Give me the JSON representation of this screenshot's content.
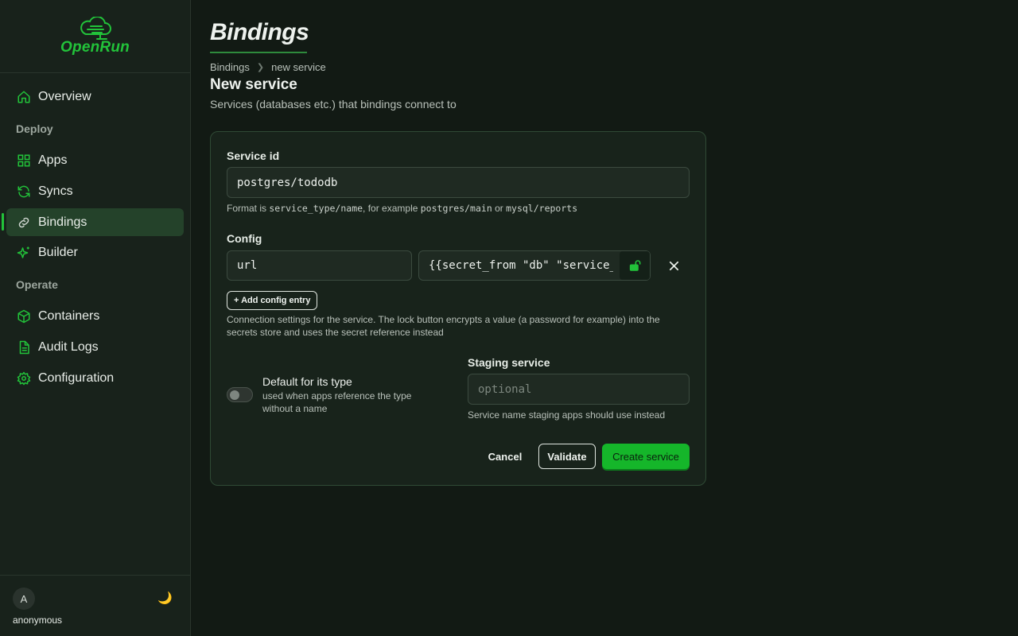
{
  "app": {
    "name": "OpenRun"
  },
  "colors": {
    "accent": "#22c33a",
    "background": "#121a14",
    "sidebar": "#18221b",
    "active_item": "#24422a",
    "primary_button": "#15b62a"
  },
  "sidebar": {
    "items": [
      {
        "label": "Overview",
        "icon": "home-icon"
      },
      {
        "label": "Apps",
        "icon": "grid-icon"
      },
      {
        "label": "Syncs",
        "icon": "refresh-icon"
      },
      {
        "label": "Bindings",
        "icon": "link-icon",
        "active": true
      },
      {
        "label": "Builder",
        "icon": "sparkle-icon"
      },
      {
        "label": "Containers",
        "icon": "box-icon"
      },
      {
        "label": "Audit Logs",
        "icon": "document-icon"
      },
      {
        "label": "Configuration",
        "icon": "gear-icon"
      }
    ],
    "sections": {
      "deploy": "Deploy",
      "operate": "Operate"
    }
  },
  "user": {
    "initial": "A",
    "name": "anonymous",
    "theme_icon": "moon-icon"
  },
  "page": {
    "title": "Bindings",
    "breadcrumb": [
      "Bindings",
      "new service"
    ],
    "heading": "New service",
    "subheading": "Services (databases etc.) that bindings connect to"
  },
  "form": {
    "service_id": {
      "label": "Service id",
      "value": "postgres/tododb",
      "help_prefix": "Format is ",
      "help_code1": "service_type/name",
      "help_mid": ", for example ",
      "help_code2": "postgres/main",
      "help_or": " or ",
      "help_code3": "mysql/reports"
    },
    "config": {
      "label": "Config",
      "entries": [
        {
          "key": "url",
          "value": "{{secret_from \"db\" \"service_url\"}}"
        }
      ],
      "add_label": "+ Add config entry",
      "help": "Connection settings for the service. The lock button encrypts a value (a password for example) into the secrets store and uses the secret reference instead"
    },
    "default_toggle": {
      "title": "Default for its type",
      "description": "used when apps reference the type without a name",
      "checked": false
    },
    "staging": {
      "label": "Staging service",
      "value": "",
      "placeholder": "optional",
      "help": "Service name staging apps should use instead"
    },
    "buttons": {
      "cancel": "Cancel",
      "validate": "Validate",
      "create": "Create service"
    }
  }
}
